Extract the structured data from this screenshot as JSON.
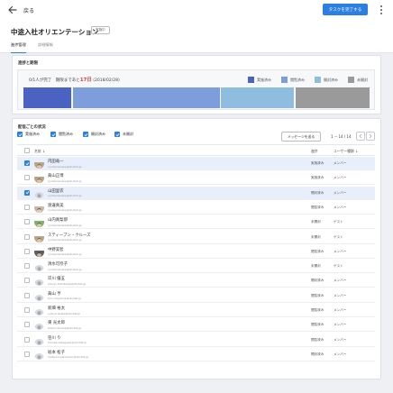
{
  "topbar": {
    "back_label": "戻る",
    "complete_button": "タスクを完了する"
  },
  "header": {
    "title": "中途入社オリエンテーション",
    "badge": "実施中",
    "tabs": [
      {
        "label": "進捗管理",
        "active": true
      },
      {
        "label": "詳細情報",
        "active": false
      }
    ]
  },
  "progress": {
    "section_title": "進捗と期限",
    "completed": 1,
    "total": 14,
    "text_prefix": "0/1人が完了　期限まであと",
    "days": "17日",
    "deadline": "(2018/02/28)",
    "legend": [
      {
        "label": "実施済み",
        "color": "#4a63c2"
      },
      {
        "label": "閲覧済み",
        "color": "#7d9edb"
      },
      {
        "label": "開封済み",
        "color": "#8fbde0"
      },
      {
        "label": "未開封",
        "color": "#9a9a9a"
      }
    ],
    "breakdown": [
      {
        "status": "実施済み",
        "count": 2
      },
      {
        "status": "閲覧済み",
        "count": 6
      },
      {
        "status": "開封済み",
        "count": 3
      },
      {
        "status": "未開封",
        "count": 3
      }
    ]
  },
  "status_section": {
    "title": "配信ごとの状況",
    "filters": [
      {
        "label": "実施済み",
        "checked": true
      },
      {
        "label": "閲覧済み",
        "checked": true
      },
      {
        "label": "開封済み",
        "checked": true
      },
      {
        "label": "未開封",
        "checked": true
      }
    ],
    "message_button": "メッセージを送る",
    "pager": "1 − 14 / 14",
    "columns": {
      "name": "名前",
      "status": "進捗",
      "user_type": "ユーザー種類"
    },
    "rows": [
      {
        "name": "内田竜一",
        "email": "ryuhei.tanaka@studist.jp",
        "status": "実施済み",
        "type": "メンバー",
        "selected": true,
        "checked": true,
        "avatar": "photo-man"
      },
      {
        "name": "眞山正博",
        "email": "ryuhei.tanaka@studist.jp",
        "status": "実施済み",
        "type": "メンバー",
        "selected": false,
        "checked": false,
        "avatar": "photo-man"
      },
      {
        "name": "山田里衣",
        "email": "ryuhei.tanaka@studist.jp",
        "status": "開封済み",
        "type": "メンバー",
        "selected": true,
        "checked": true,
        "avatar": "default"
      },
      {
        "name": "渡邊真美",
        "email": "ryuhei.tanaka@studist.jp",
        "status": "閲覧済み",
        "type": "メンバー",
        "selected": false,
        "checked": false,
        "avatar": "photo-woman"
      },
      {
        "name": "山内真梨那",
        "email": "ryuhei.tanaka@studist.jp",
        "status": "未開封",
        "type": "ゲスト",
        "selected": false,
        "checked": false,
        "avatar": "photo-green"
      },
      {
        "name": "スティーブン・クルーズ",
        "email": "ryuhei.tanaka@studist.jp",
        "status": "未開封",
        "type": "ゲスト",
        "selected": false,
        "checked": false,
        "avatar": "photo-man"
      },
      {
        "name": "中野美智",
        "email": "ryuhei.tanaka@studist.jp",
        "status": "閲覧済み",
        "type": "メンバー",
        "selected": false,
        "checked": false,
        "avatar": "photo-dark"
      },
      {
        "name": "清水可奈子",
        "email": "ryuhei.tanaka@studist.jp",
        "status": "未開封",
        "type": "ゲスト",
        "selected": false,
        "checked": false,
        "avatar": "default"
      },
      {
        "name": "岸川 優五",
        "email": "shingo.kishikawa@studist.jp",
        "status": "開封済み",
        "type": "メンバー",
        "selected": false,
        "checked": false,
        "avatar": "default"
      },
      {
        "name": "眞山 亨",
        "email": "toru.mayama@studist.jp",
        "status": "閲覧済み",
        "type": "メンバー",
        "selected": false,
        "checked": false,
        "avatar": "default"
      },
      {
        "name": "新畑 裕太",
        "email": "yuta.arahata@studist.jp",
        "status": "閲覧済み",
        "type": "メンバー",
        "selected": false,
        "checked": false,
        "avatar": "default"
      },
      {
        "name": "東 光太郎",
        "email": "kotaro.azuma@studist.jp",
        "status": "閲覧済み",
        "type": "メンバー",
        "selected": false,
        "checked": false,
        "avatar": "default"
      },
      {
        "name": "笹川 り",
        "email": "haruka.sasagawa@studist.jp",
        "status": "閲覧済み",
        "type": "メンバー",
        "selected": false,
        "checked": false,
        "avatar": "default"
      },
      {
        "name": "坂本 松子",
        "email": "matsuko.sakamoto@studist.jp",
        "status": "開封済み",
        "type": "メンバー",
        "selected": false,
        "checked": false,
        "avatar": "default"
      }
    ]
  }
}
